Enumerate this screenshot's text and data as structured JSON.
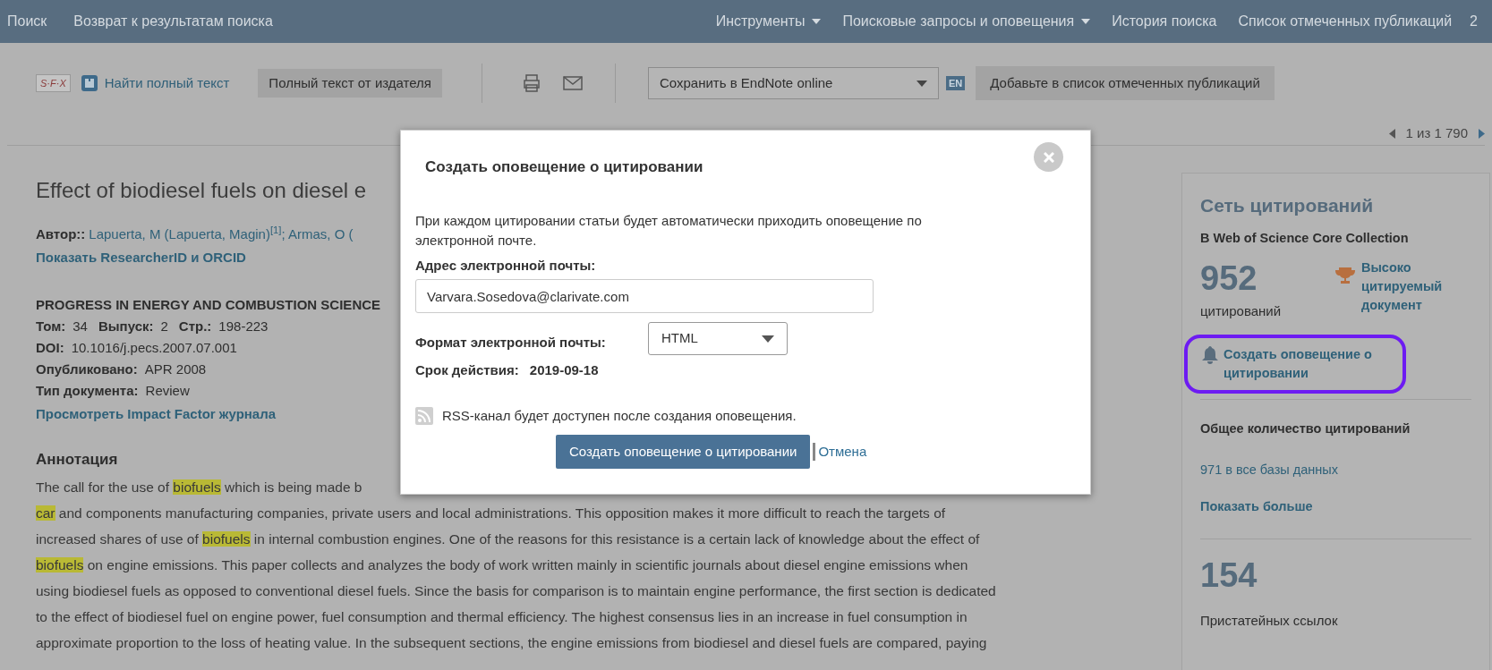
{
  "nav": {
    "left": [
      "Поиск",
      "Возврат к результатам поиска"
    ],
    "right": [
      {
        "label": "Инструменты",
        "dropdown": true
      },
      {
        "label": "Поисковые запросы и оповещения",
        "dropdown": true
      },
      {
        "label": "История поиска",
        "dropdown": false
      },
      {
        "label": "Список отмеченных публикаций",
        "dropdown": false
      }
    ],
    "count": "2"
  },
  "toolbar": {
    "sfx": "S·F·X",
    "find_full_text": "Найти полный текст",
    "publisher_button": "Полный текст от издателя",
    "save_select": "Сохранить в EndNote online",
    "en_logo": "EN",
    "marked_list_button": "Добавьте в список отмеченных публикаций"
  },
  "pager": "1 из 1 790",
  "record": {
    "title": "Effect of biodiesel fuels on diesel e",
    "author_label": "Автор::",
    "authors": "Lapuerta, M (Lapuerta, Magin)$^{[1]}$; Armas, O (",
    "show_ids": "Показать ResearcherID и ORCID",
    "journal": "PROGRESS IN ENERGY AND COMBUSTION SCIENCE",
    "volume_label": "Том:",
    "volume": "34",
    "issue_label": "Выпуск:",
    "issue": "2",
    "pages_label": "Стр.:",
    "pages": "198-223",
    "fields": [
      {
        "label": "DOI:",
        "value": "10.1016/j.pecs.2007.07.001"
      },
      {
        "label": "Опубликовано:",
        "value": "APR 2008"
      },
      {
        "label": "Тип документа:",
        "value": "Review"
      }
    ],
    "impact_link": "Просмотреть Impact Factor журнала",
    "abstract_heading": "Аннотация",
    "abstract_lines": [
      [
        {
          "text": "The call for the use of ",
          "highlight": false
        },
        {
          "text": "biofuels",
          "highlight": true
        },
        {
          "text": " which is being made b",
          "highlight": false
        }
      ],
      [
        {
          "text": "car",
          "highlight": true
        },
        {
          "text": " and components manufacturing companies, private users and local administrations. This opposition makes it more difficult to reach the targets of",
          "highlight": false
        }
      ],
      [
        {
          "text": "increased shares of use of ",
          "highlight": false
        },
        {
          "text": "biofuels",
          "highlight": true
        },
        {
          "text": " in internal combustion engines. One of the reasons for this resistance is a certain lack of knowledge about the effect of",
          "highlight": false
        }
      ],
      [
        {
          "text": "biofuels",
          "highlight": true
        },
        {
          "text": " on engine emissions. This paper collects and analyzes the body of work written mainly in scientific journals about diesel engine emissions when",
          "highlight": false
        }
      ],
      [
        {
          "text": "using biodiesel fuels as opposed to conventional diesel fuels. Since the basis for comparison is to maintain engine performance, the first section is dedicated",
          "highlight": false
        }
      ],
      [
        {
          "text": "to the effect of biodiesel fuel on engine power, fuel consumption and thermal efficiency. The highest consensus lies in an increase in fuel consumption in",
          "highlight": false
        }
      ],
      [
        {
          "text": "approximate proportion to the loss of heating value. In the subsequent sections, the engine emissions from biodiesel and diesel fuels are compared, paying",
          "highlight": false
        }
      ]
    ]
  },
  "citation_network": {
    "title": "Сеть цитирований",
    "subtitle": "В Web of Science Core Collection",
    "count": "952",
    "count_label": "цитирований",
    "highly_cited": "Высоко цитируемый документ",
    "alert_link": "Создать оповещение о цитировании",
    "alert_circled": true,
    "total_heading": "Общее количество цитирований",
    "all_db": "971 в все базы данных",
    "show_more": "Показать больше",
    "refs_count": "154",
    "refs_label": "Пристатейных ссылок"
  },
  "dialog": {
    "title": "Создать оповещение о цитировании",
    "description": "При каждом цитировании статьи будет автоматически приходить оповещение по электронной почте.",
    "email_label": "Адрес электронной почты:",
    "email_value": "Varvara.Sosedova@clarivate.com",
    "format_label": "Формат электронной почты:",
    "format_value": "HTML",
    "expiry_label": "Срок действия:",
    "expiry_value": "2019-09-18",
    "rss_note": "RSS-канал будет доступен после создания оповещения.",
    "submit": "Создать оповещение о цитировании",
    "cancel": "Отмена"
  }
}
